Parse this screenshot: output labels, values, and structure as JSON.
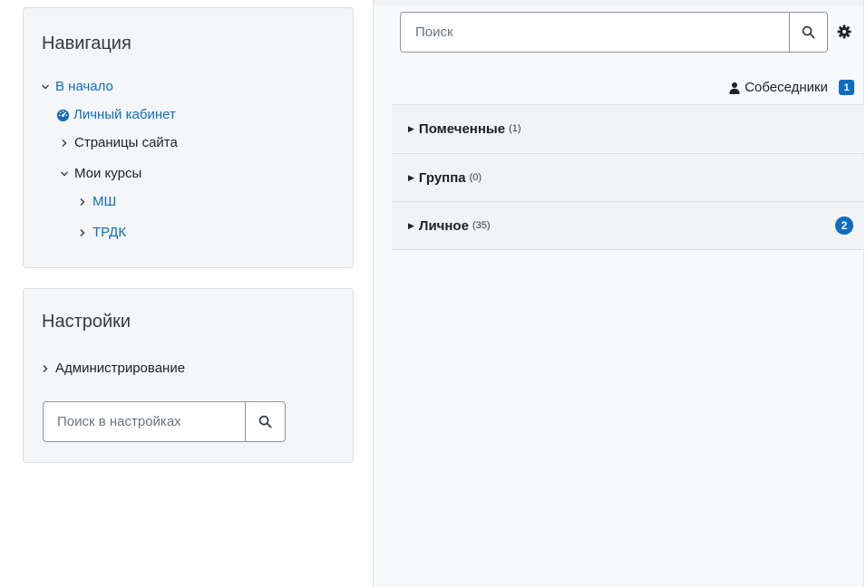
{
  "navigation": {
    "title": "Навигация",
    "home": "В начало",
    "dashboard": "Личный кабинет",
    "site_pages": "Страницы сайта",
    "my_courses": "Мои курсы",
    "courses": [
      "МШ",
      "ТРДК"
    ]
  },
  "settings": {
    "title": "Настройки",
    "administration": "Администрирование",
    "search_placeholder": "Поиск в настройках"
  },
  "messages": {
    "search_placeholder": "Поиск",
    "contacts_label": "Собеседники",
    "contacts_badge": "1",
    "sections": [
      {
        "name": "Помеченные",
        "count": "(1)",
        "badge": ""
      },
      {
        "name": "Группа",
        "count": "(0)",
        "badge": ""
      },
      {
        "name": "Личное",
        "count": "(35)",
        "badge": "2"
      }
    ]
  },
  "colors": {
    "accent": "#0f6cbf",
    "block_bg": "#f5f6f7",
    "drawer_bg": "#f8f9fa"
  },
  "icons": {
    "dashboard": "tachometer-icon",
    "contacts": "user-icon",
    "search": "search-icon",
    "settings": "gear-icon"
  }
}
